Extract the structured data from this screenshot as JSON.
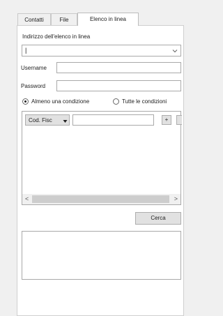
{
  "tabs": [
    "Contatti",
    "File",
    "Elenco in linea"
  ],
  "active_tab": 2,
  "address": {
    "label": "Indirizzo dell'elenco in linea",
    "value": "|"
  },
  "username": {
    "label": "Username",
    "value": ""
  },
  "password": {
    "label": "Password",
    "value": ""
  },
  "conditions": {
    "any": "Almeno una condizione",
    "all": "Tutte le condizioni",
    "selected": "any"
  },
  "criteria": {
    "field_select": "Cod. Fisc",
    "value": "",
    "add_label": "+"
  },
  "scroll": {
    "left": "<",
    "right": ">"
  },
  "search_button": "Cerca",
  "results_text": ""
}
